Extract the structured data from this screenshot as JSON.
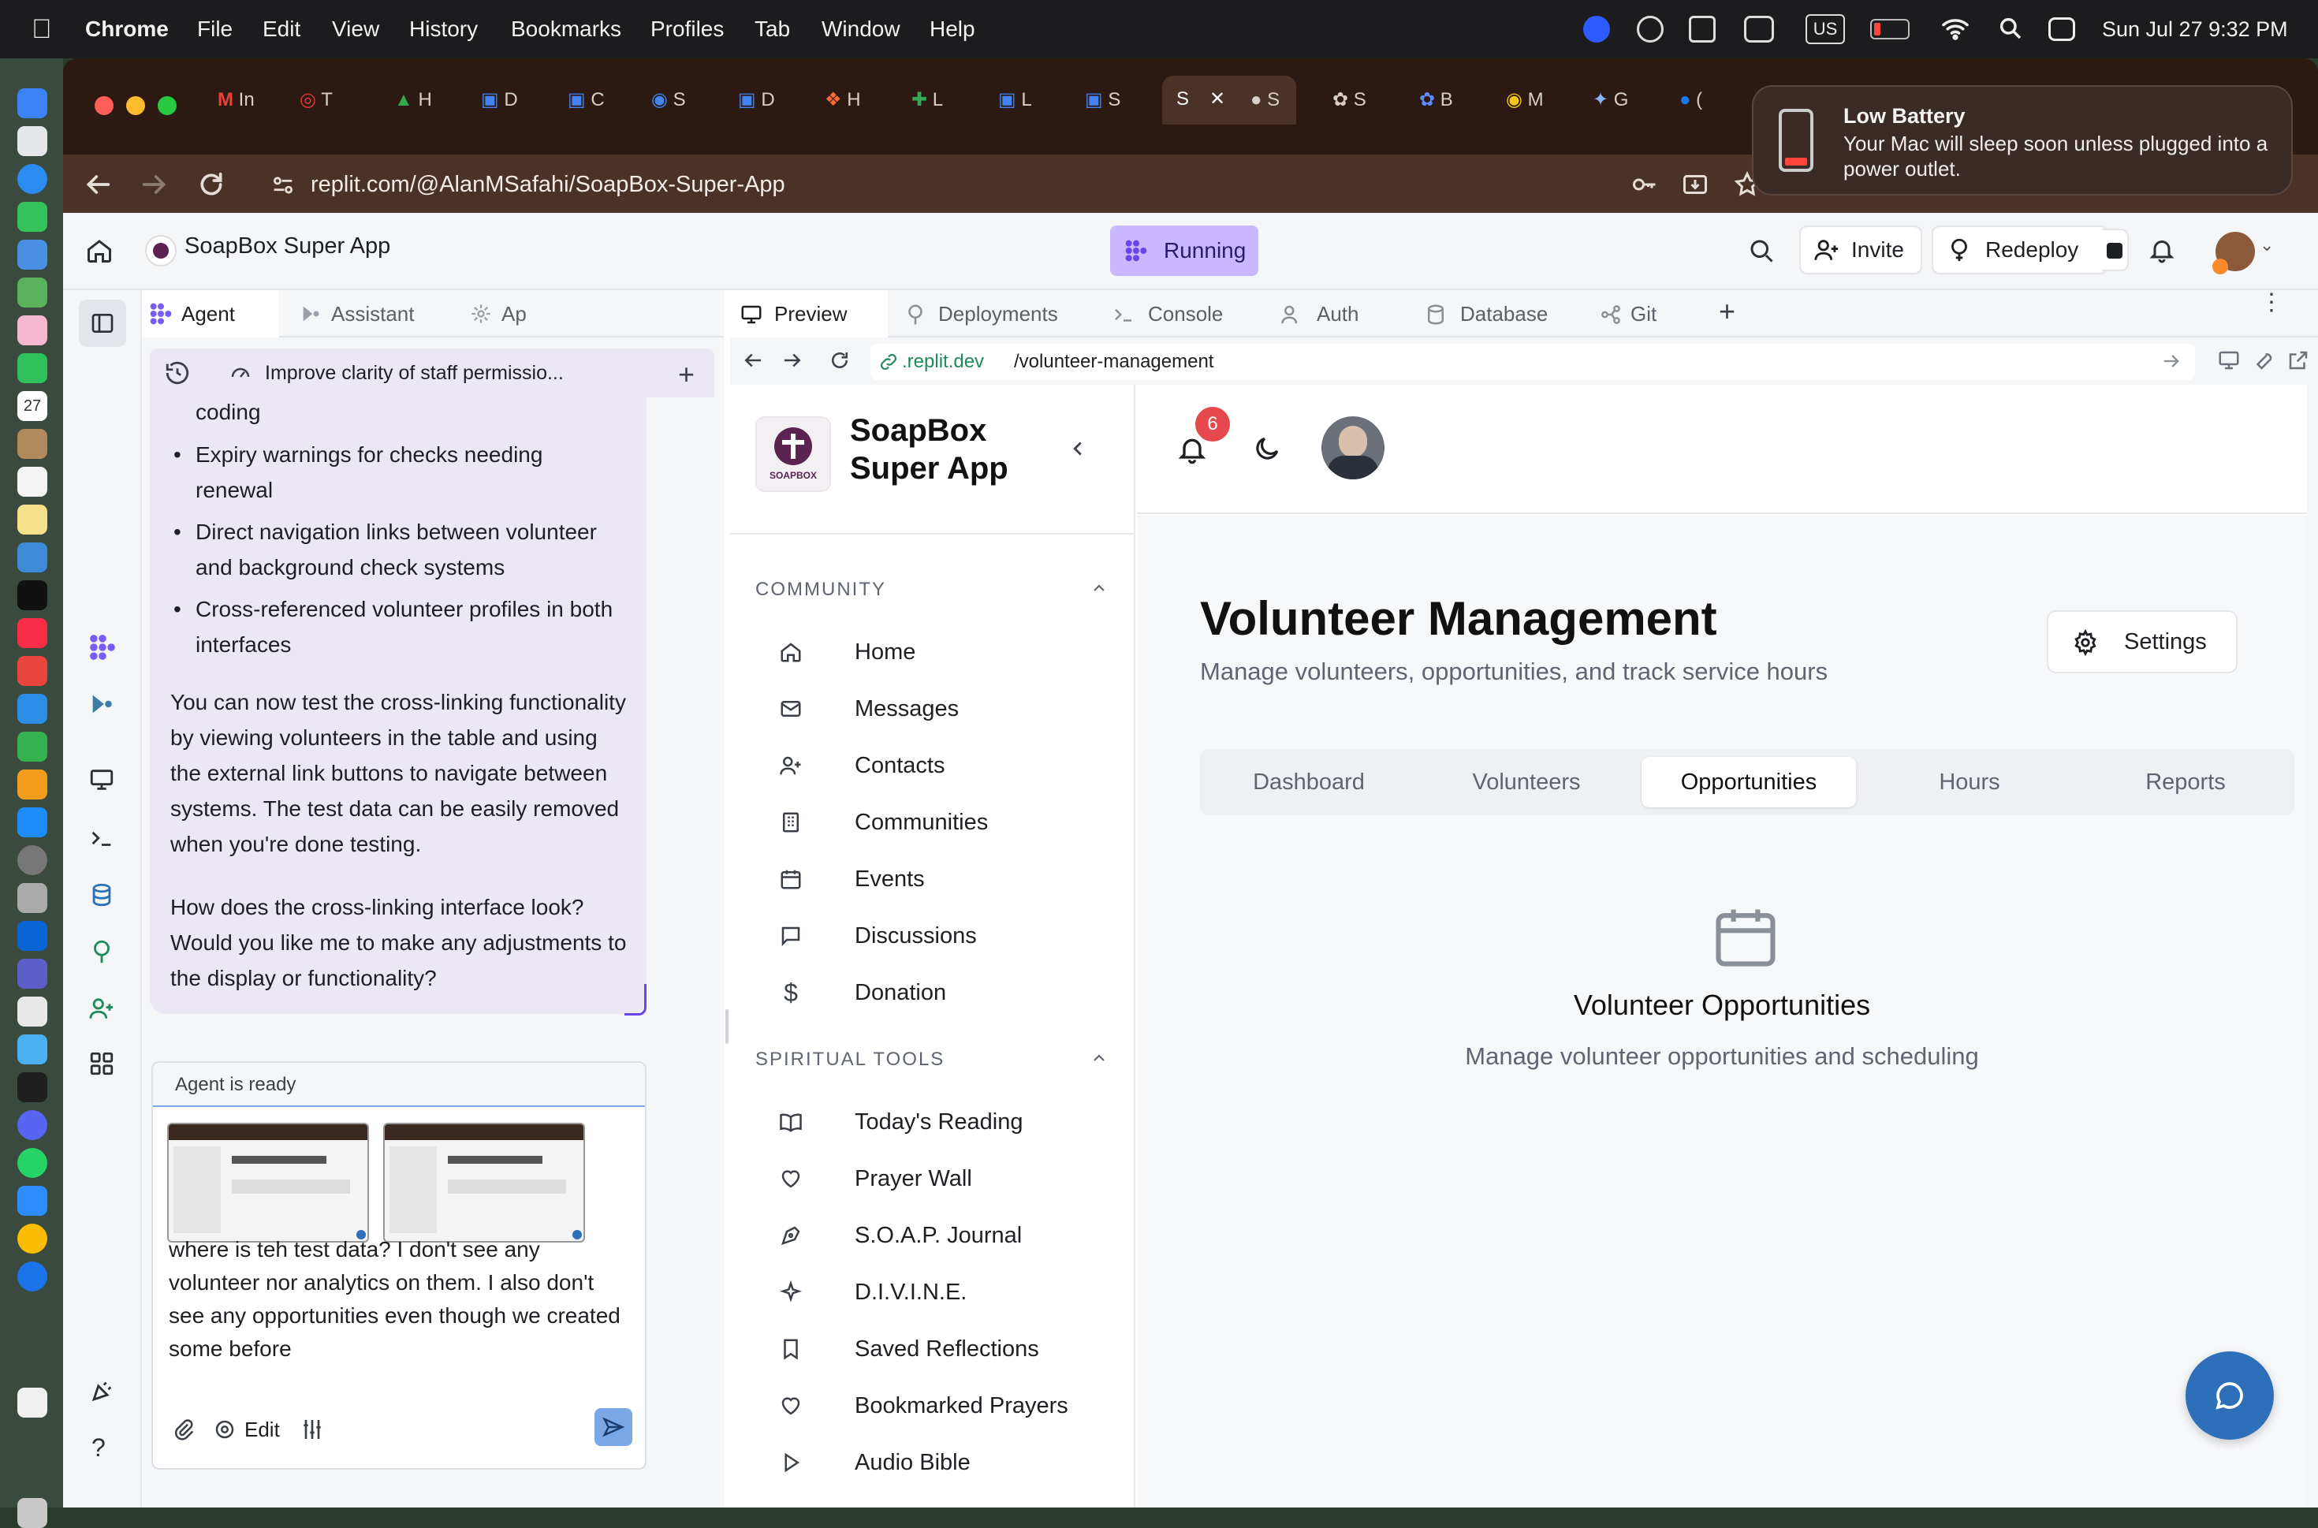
{
  "menubar": {
    "app": "Chrome",
    "items": [
      "File",
      "Edit",
      "View",
      "History",
      "Bookmarks",
      "Profiles",
      "Tab",
      "Window",
      "Help"
    ],
    "keyboard": "US",
    "clock": "Sun Jul 27  9:32 PM"
  },
  "browser": {
    "tabs": [
      "In",
      "T",
      "H",
      "D",
      "C",
      "S",
      "D",
      "H",
      "L",
      "L",
      "S",
      "S",
      "S",
      "S",
      "B",
      "M",
      "G",
      "("
    ],
    "active_tab_index": 12,
    "url": "replit.com/@AlanMSafahi/SoapBox-Super-App"
  },
  "notification": {
    "title": "Low Battery",
    "body": "Your Mac will sleep soon unless plugged into a power outlet."
  },
  "replit": {
    "project": "SoapBox Super App",
    "run_status": "Running",
    "invite": "Invite",
    "redeploy": "Redeploy",
    "left_tabs": [
      "Agent",
      "Assistant",
      "Ap"
    ],
    "thread_title": "Improve clarity of staff permissio...",
    "right_tabs": [
      "Preview",
      "Deployments",
      "Console",
      "Auth",
      "Database",
      "Git"
    ],
    "preview_url_host": ".replit.dev",
    "preview_url_path": "/volunteer-management"
  },
  "chat": {
    "partial_top": "coding",
    "bullets": [
      "Expiry warnings for checks needing renewal",
      "Direct navigation links between volunteer and background check systems",
      "Cross-referenced volunteer profiles in both interfaces"
    ],
    "paragraph1": "You can now test the cross-linking functionality by viewing volunteers in the table and using the external link buttons to navigate between systems. The test data can be easily removed when you're done testing.",
    "paragraph2": "How does the cross-linking interface look? Would you like me to make any adjustments to the display or functionality?",
    "status": "Agent is ready",
    "input": "where is teh test data? I don't see any volunteer nor analytics on them. I also don't see any opportunities even though we created some before",
    "edit": "Edit"
  },
  "app": {
    "brand_line1": "SoapBox",
    "brand_line2": "Super App",
    "logo_text": "SOAPBOX",
    "notif_count": "6",
    "community_label": "COMMUNITY",
    "community_items": [
      "Home",
      "Messages",
      "Contacts",
      "Communities",
      "Events",
      "Discussions",
      "Donation"
    ],
    "spiritual_label": "SPIRITUAL TOOLS",
    "spiritual_items": [
      "Today's Reading",
      "Prayer Wall",
      "S.O.A.P. Journal",
      "D.I.V.I.N.E.",
      "Saved Reflections",
      "Bookmarked Prayers",
      "Audio Bible"
    ],
    "page_title": "Volunteer Management",
    "page_subtitle": "Manage volunteers, opportunities, and track service hours",
    "settings": "Settings",
    "tabs": [
      "Dashboard",
      "Volunteers",
      "Opportunities",
      "Hours",
      "Reports"
    ],
    "active_tab": "Opportunities",
    "empty_title": "Volunteer Opportunities",
    "empty_sub": "Manage volunteer opportunities and scheduling"
  },
  "colors": {
    "accent": "#7a5cf5",
    "running_bg": "#c9b8ff",
    "badge": "#e5484d",
    "chat_bg": "#ebe8f4",
    "fab": "#2d6fb8"
  }
}
